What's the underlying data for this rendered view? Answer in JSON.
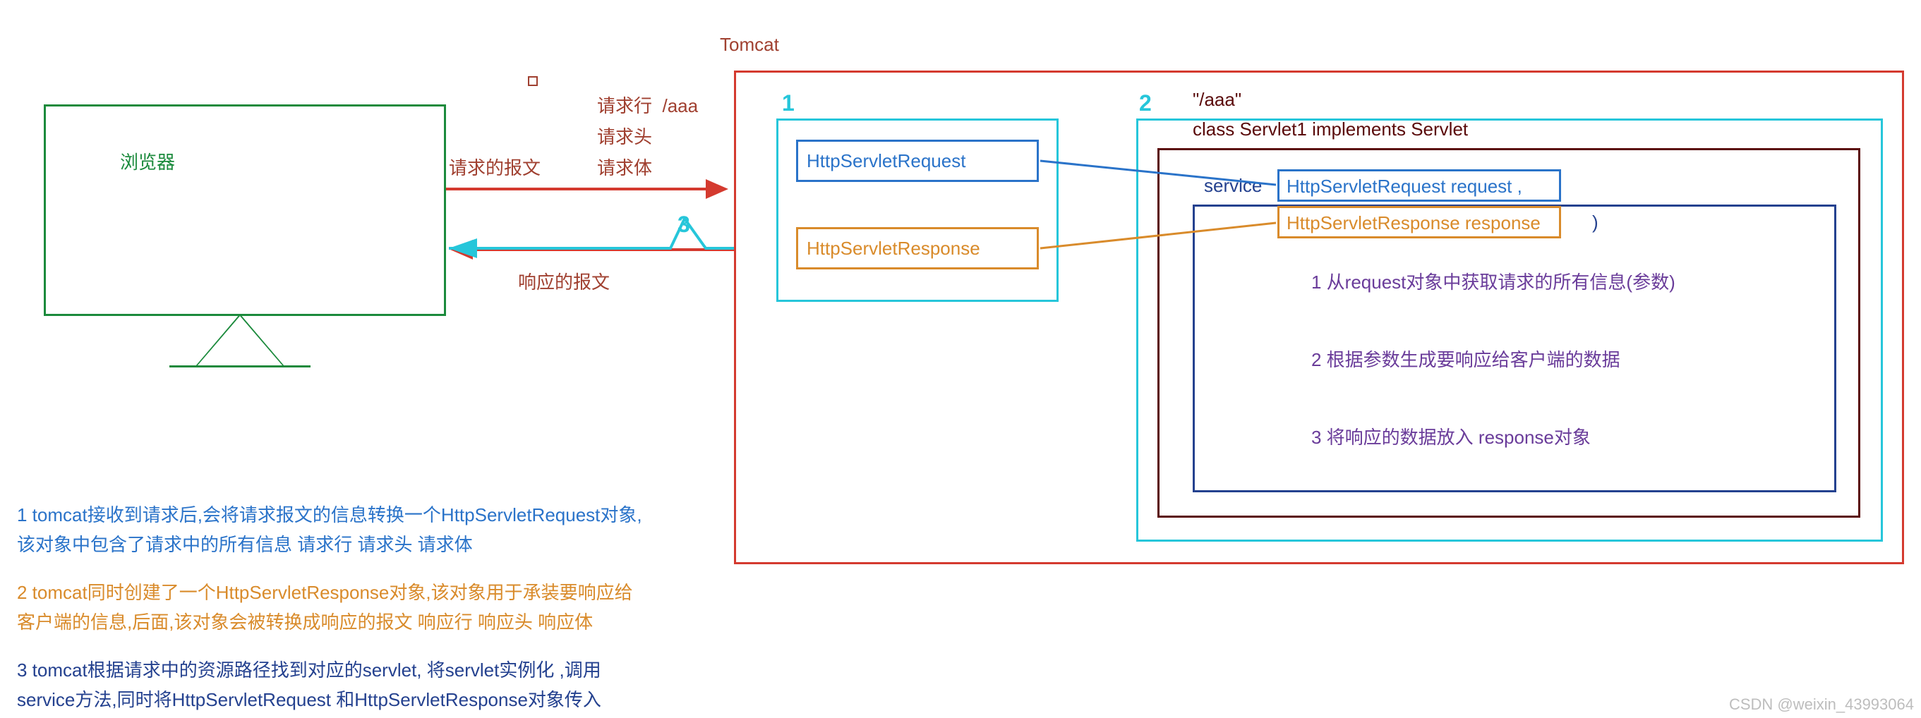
{
  "monitor": {
    "label": "浏览器"
  },
  "request": {
    "heading": "请求的报文",
    "line": "请求行",
    "linePath": "/aaa",
    "headers": "请求头",
    "body": "请求体"
  },
  "response": {
    "heading": "响应的报文"
  },
  "tomcat": {
    "label": "Tomcat"
  },
  "boxes": {
    "num1": "1",
    "num2": "2",
    "num3": "3",
    "httpReq": "HttpServletRequest",
    "httpRes": "HttpServletResponse",
    "path": "\"/aaa\"",
    "classDecl": "class Servlet1    implements Servlet",
    "service": "service",
    "param1": "HttpServletRequest request ,",
    "param2": "HttpServletResponse response",
    "paren": ")",
    "steps": {
      "s1": "1 从request对象中获取请求的所有信息(参数)",
      "s2": "2 根据参数生成要响应给客户端的数据",
      "s3": "3 将响应的数据放入 response对象"
    }
  },
  "notes": {
    "n1a": "1 tomcat接收到请求后,会将请求报文的信息转换一个HttpServletRequest对象,",
    "n1b": "该对象中包含了请求中的所有信息    请求行 请求头 请求体",
    "n2a": "2 tomcat同时创建了一个HttpServletResponse对象,该对象用于承装要响应给",
    "n2b": "客户端的信息,后面,该对象会被转换成响应的报文  响应行  响应头 响应体",
    "n3a": "3 tomcat根据请求中的资源路径找到对应的servlet, 将servlet实例化 ,调用",
    "n3b": "service方法,同时将HttpServletRequest 和HttpServletResponse对象传入"
  },
  "watermark": "CSDN @weixin_43993064"
}
